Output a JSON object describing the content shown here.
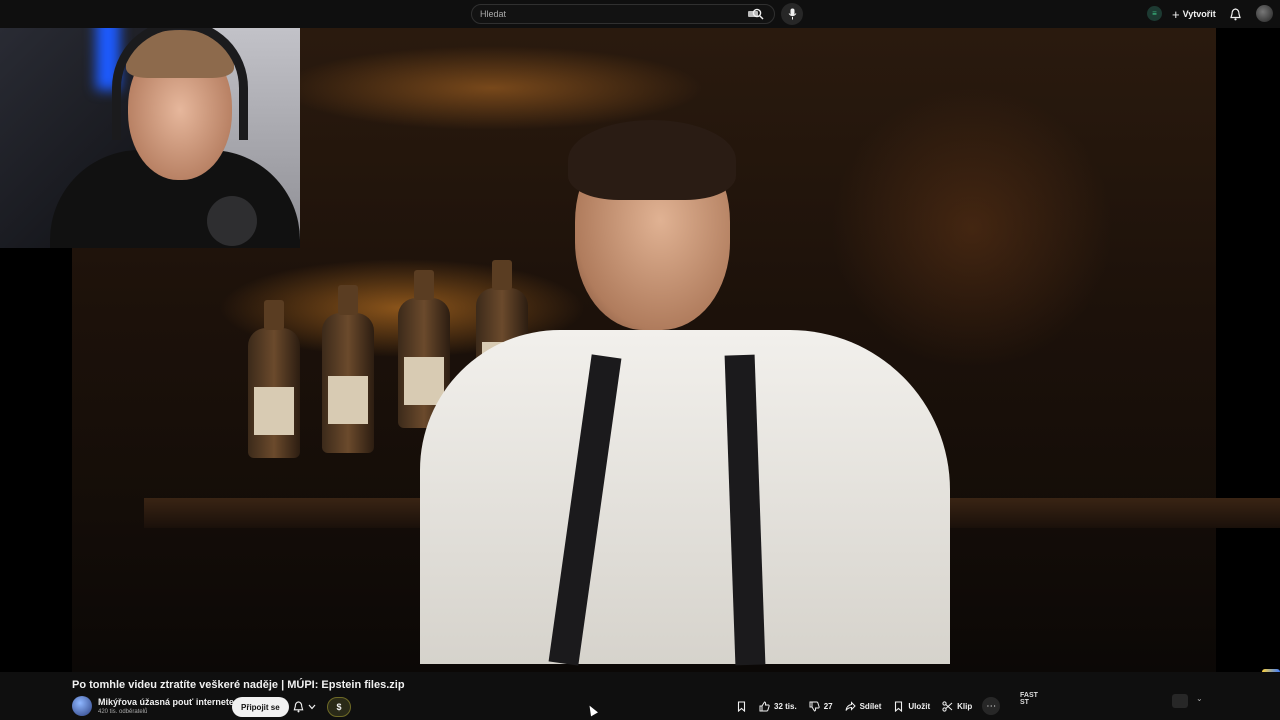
{
  "search": {
    "placeholder": "Hledat"
  },
  "header": {
    "create_label": "Vytvořit"
  },
  "video": {
    "title": "Po tomhle videu ztratíte veškeré naděje | MÚPI: Epstein files.zip",
    "channel_name": "Mikýřova úžasná pouť internetem",
    "subscribers": "420 tis. odběratelů",
    "join_label": "Připojit se",
    "dollar_label": "$",
    "likes": "32 tis.",
    "dislikes": "27",
    "share_label": "Sdílet",
    "save_label": "Uložit",
    "clip_label": "Klip",
    "more_label": "⋯"
  },
  "side_panel": {
    "logo_text": "FAST\nST"
  },
  "colors": {
    "background": "#0f0f0f",
    "accent": "#f1f1f1",
    "join_bg": "#f1f1f1"
  }
}
